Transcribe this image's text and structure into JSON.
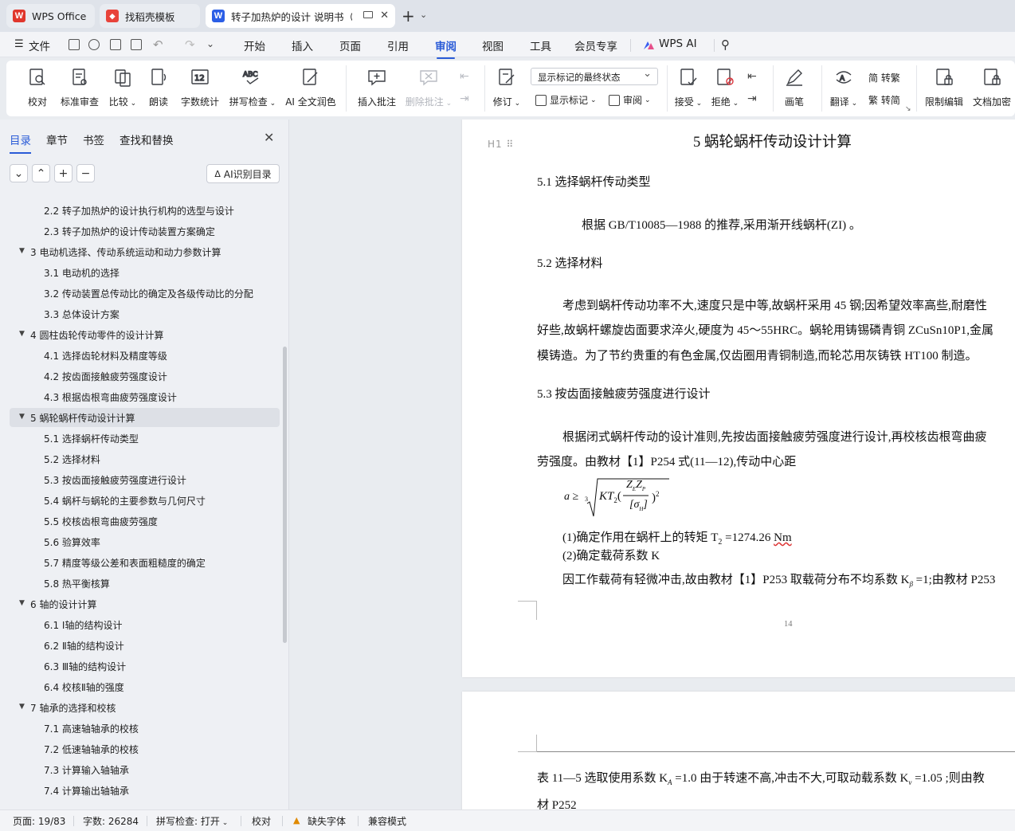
{
  "tabs": [
    {
      "label": "WPS Office",
      "logo": "W",
      "color": "#e0362c"
    },
    {
      "label": "找稻壳模板",
      "logo": "◆",
      "color": "#e8433a"
    },
    {
      "label": "转子加热炉的设计 说明书（论",
      "logo": "W",
      "color": "#2b5ee6"
    }
  ],
  "menu": {
    "file": "文件",
    "items": [
      "开始",
      "插入",
      "页面",
      "引用",
      "审阅",
      "视图",
      "工具",
      "会员专享"
    ],
    "active": "审阅",
    "wps_ai": "WPS AI"
  },
  "ribbon": {
    "proofread": "校对",
    "standard_review": "标准审查",
    "compare": "比较",
    "read_aloud": "朗读",
    "word_count": "字数统计",
    "spell_check": "拼写检查",
    "ai_polish": "AI 全文润色",
    "insert_comment": "插入批注",
    "delete_comment": "删除批注",
    "revise": "修订",
    "display_dropdown": "显示标记的最终状态",
    "show_markup": "显示标记",
    "review": "审阅",
    "accept": "接受",
    "reject": "拒绝",
    "brush": "画笔",
    "translate": "翻译",
    "to_traditional": "简 转繁",
    "to_simplified": "繁 转简",
    "restrict_edit": "限制编辑",
    "doc_encrypt": "文档加密"
  },
  "leftpanel": {
    "tabs": [
      "目录",
      "章节",
      "书签",
      "查找和替换"
    ],
    "ai_button": "AI识别目录",
    "toc": [
      {
        "level": 2,
        "text": "2.2  转子加热炉的设计执行机构的选型与设计"
      },
      {
        "level": 2,
        "text": "2.3  转子加热炉的设计传动装置方案确定"
      },
      {
        "level": 1,
        "text": "3    电动机选择、传动系统运动和动力参数计算"
      },
      {
        "level": 2,
        "text": "3.1 电动机的选择"
      },
      {
        "level": 2,
        "text": "3.2  传动装置总传动比的确定及各级传动比的分配"
      },
      {
        "level": 2,
        "text": "3.3  总体设计方案"
      },
      {
        "level": 1,
        "text": "4    圆柱齿轮传动零件的设计计算"
      },
      {
        "level": 2,
        "text": "4.1  选择齿轮材料及精度等级"
      },
      {
        "level": 2,
        "text": "4.2 按齿面接触疲劳强度设计"
      },
      {
        "level": 2,
        "text": "4.3  根据齿根弯曲疲劳强度设计"
      },
      {
        "level": 1,
        "text": "5    蜗轮蜗杆传动设计计算",
        "selected": true
      },
      {
        "level": 2,
        "text": "5.1  选择蜗杆传动类型"
      },
      {
        "level": 2,
        "text": "5.2  选择材料"
      },
      {
        "level": 2,
        "text": "5.3  按齿面接触疲劳强度进行设计"
      },
      {
        "level": 2,
        "text": "5.4  蜗杆与蜗轮的主要参数与几何尺寸"
      },
      {
        "level": 2,
        "text": "5.5  校核齿根弯曲疲劳强度"
      },
      {
        "level": 2,
        "text": "5.6  验算效率"
      },
      {
        "level": 2,
        "text": "5.7  精度等级公差和表面粗糙度的确定"
      },
      {
        "level": 2,
        "text": "5.8  热平衡核算"
      },
      {
        "level": 1,
        "text": "6    轴的设计计算"
      },
      {
        "level": 2,
        "text": "6.1 Ⅰ轴的结构设计"
      },
      {
        "level": 2,
        "text": "6.2 Ⅱ轴的结构设计"
      },
      {
        "level": 2,
        "text": "6.3 Ⅲ轴的结构设计"
      },
      {
        "level": 2,
        "text": "6.4  校核Ⅱ轴的强度"
      },
      {
        "level": 1,
        "text": "7    轴承的选择和校核"
      },
      {
        "level": 2,
        "text": "7.1  高速轴轴承的校核"
      },
      {
        "level": 2,
        "text": "7.2  低速轴轴承的校核"
      },
      {
        "level": 2,
        "text": "7.3  计算输入轴轴承"
      },
      {
        "level": 2,
        "text": "7.4  计算输出轴轴承"
      }
    ]
  },
  "document": {
    "heading_mark": "H1",
    "chapter_title": "5    蜗轮蜗杆传动设计计算",
    "s51": "5.1  选择蜗杆传动类型",
    "p51": "根据 GB/T10085—1988 的推荐,采用渐开线蜗杆(ZI) 。",
    "s52": "5.2  选择材料",
    "p52_1": "考虑到蜗杆传动功率不大,速度只是中等,故蜗杆采用 45 钢;因希望效率高些,耐磨性",
    "p52_2": "好些,故蜗杆螺旋齿面要求淬火,硬度为 45～55HRC。蜗轮用铸锡磷青铜 ZCuSn10P1,金属",
    "p52_3": "模铸造。为了节约贵重的有色金属,仅齿圈用青铜制造,而轮芯用灰铸铁 HT100 制造。",
    "s53": "5.3  按齿面接触疲劳强度进行设计",
    "p53_1": "根据闭式蜗杆传动的设计准则,先按齿面接触疲劳强度进行设计,再校核齿根弯曲疲",
    "p53_2": "劳强度。由教材【1】P254 式(11—12),传动中心距",
    "formula": {
      "lhs": "a ≥",
      "root_index": "3",
      "kt": "KT",
      "kt_sub": "2",
      "num": "Z",
      "num_sub1": "E",
      "num_sub2": "P",
      "den": "[σ",
      "den_sub": "H",
      "den_close": "]",
      "exp": "2"
    },
    "item1": "(1)确定作用在蜗杆上的转矩 T",
    "item1_sub": "2",
    "item1_val": " =1274.26 ",
    "item1_unit": "Nm",
    "item2": "(2)确定载荷系数 K",
    "p_load_a": "因工作载荷有轻微冲击,故由教材【1】P253 取载荷分布不均系数 K",
    "p_load_sub": "β",
    "p_load_b": " =1;由教材 P253",
    "page_number": "14",
    "next_line1_a": "表 11—5 选取使用系数 K",
    "next_line1_sub": "A",
    "next_line1_b": " =1.0 由于转速不高,冲击不大,可取动载系数 K",
    "next_line1_sub2": "v",
    "next_line1_c": " =1.05 ;则由教",
    "next_line2": "材 P252"
  },
  "status": {
    "page": "页面: 19/83",
    "words": "字数: 26284",
    "spell": "拼写检查: 打开",
    "proof": "校对",
    "missing_font": "缺失字体",
    "compat": "兼容模式"
  }
}
